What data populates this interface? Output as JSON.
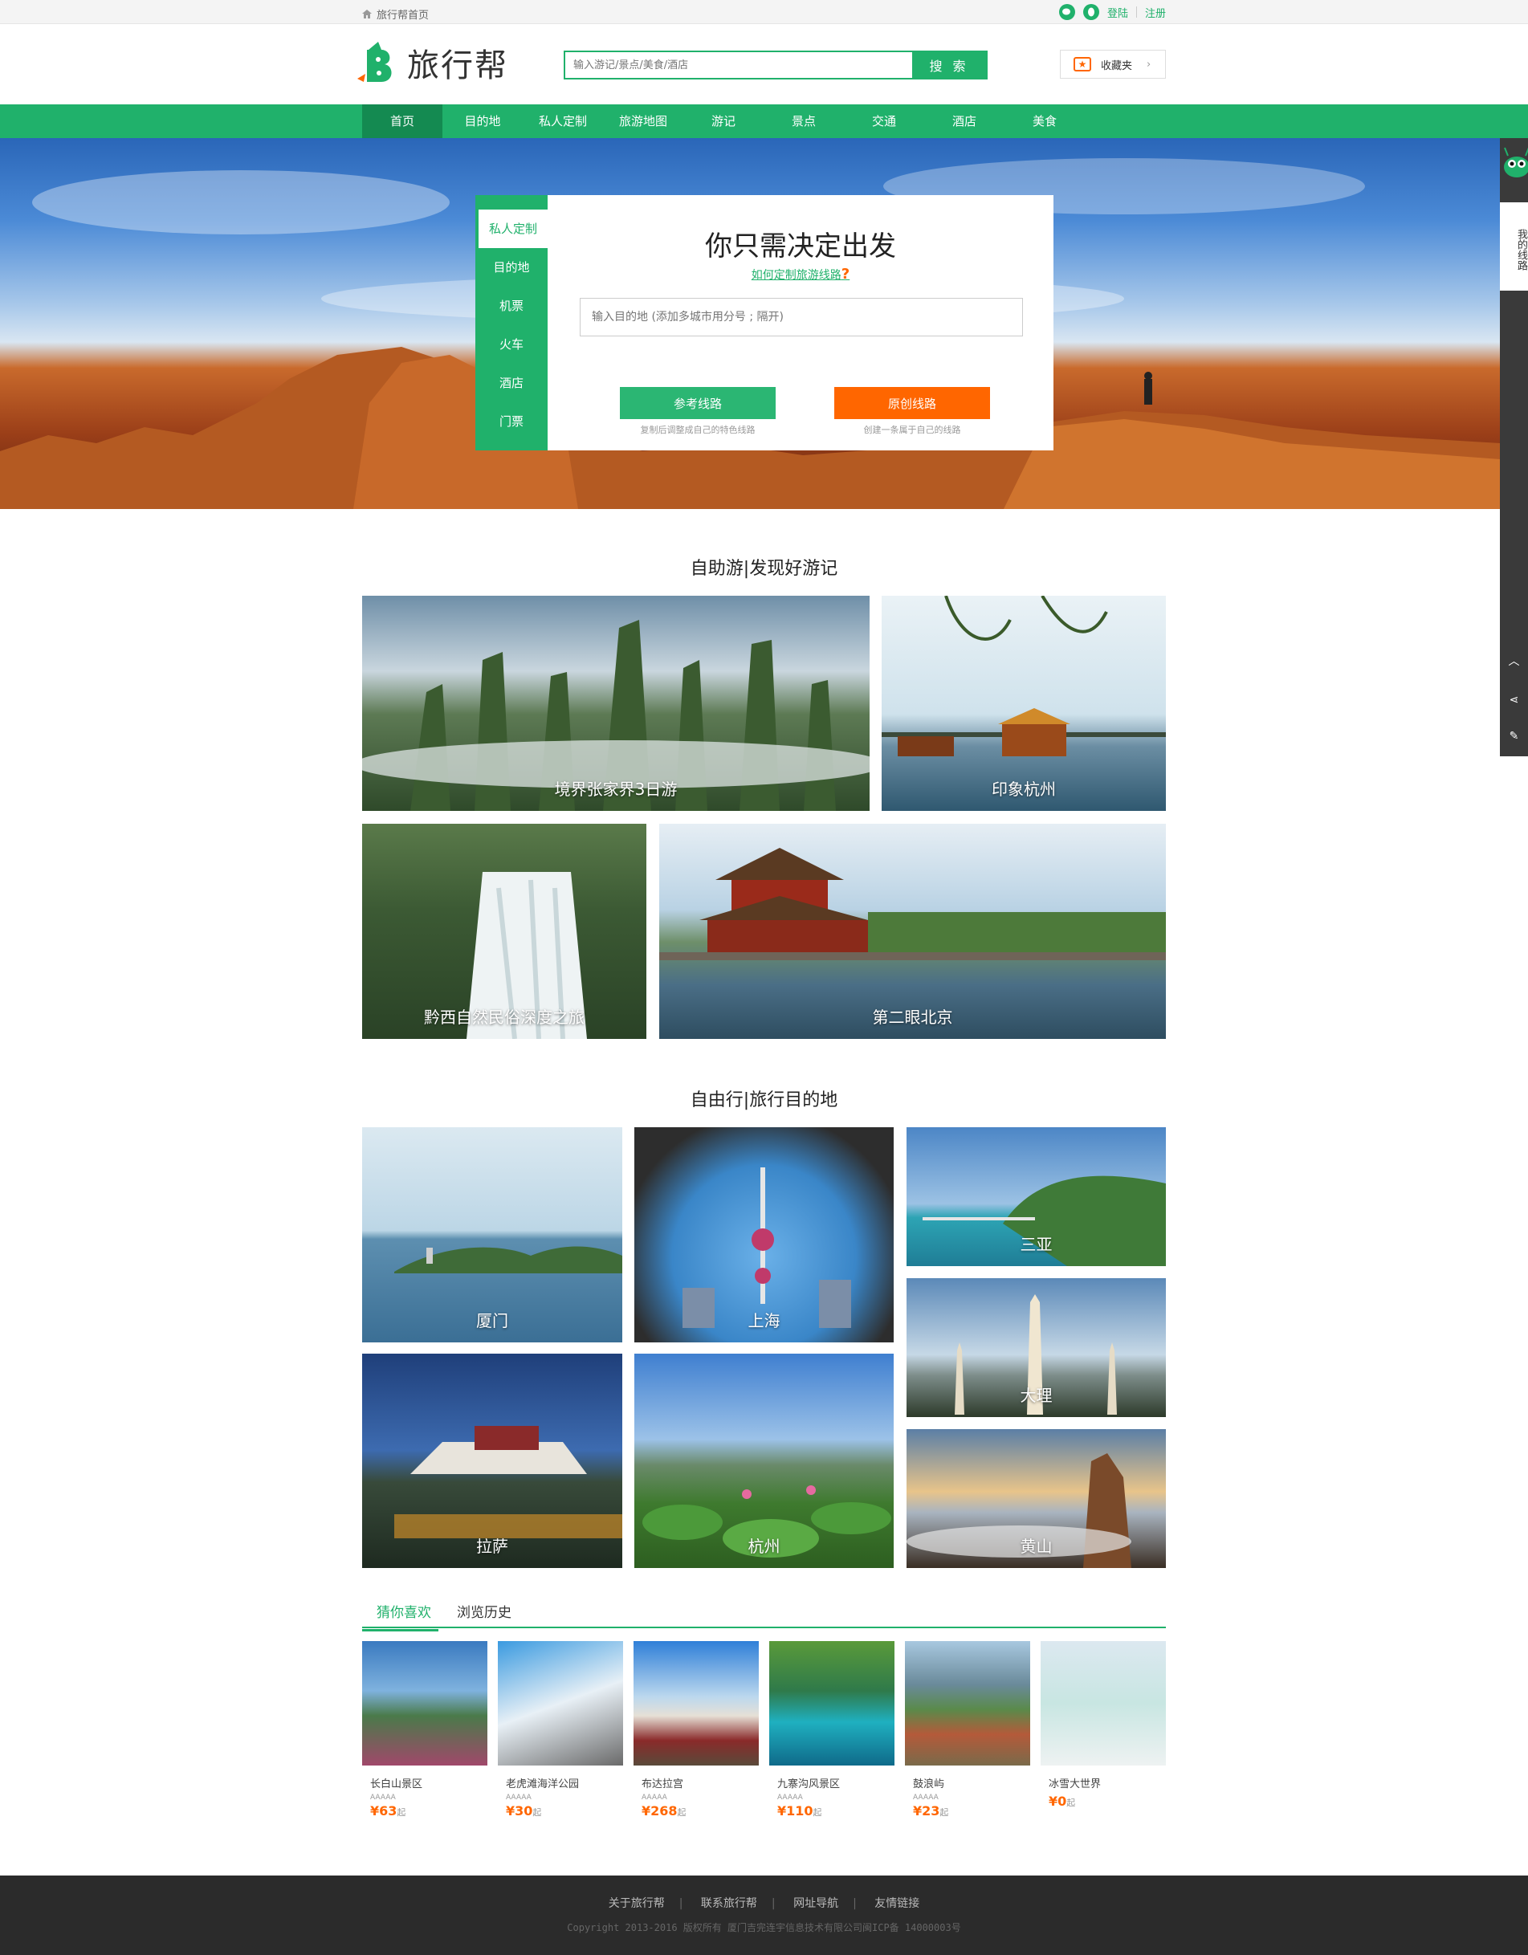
{
  "topbar": {
    "home": "旅行帮首页",
    "login": "登陆",
    "register": "注册",
    "social_icons": [
      "wechat-icon",
      "qq-icon"
    ]
  },
  "header": {
    "logo_text": "旅行帮",
    "search_placeholder": "输入游记/景点/美食/酒店",
    "search_button": "搜 索",
    "favorites": "收藏夹"
  },
  "nav": [
    "首页",
    "目的地",
    "私人定制",
    "旅游地图",
    "游记",
    "景点",
    "交通",
    "酒店",
    "美食"
  ],
  "hero": {
    "tabs": [
      "私人定制",
      "目的地",
      "机票",
      "火车",
      "酒店",
      "门票"
    ],
    "title": "你只需决定出发",
    "link": "如何定制旅游线路",
    "link_icon": "question-icon",
    "input_placeholder": "输入目的地 (添加多城市用分号 ; 隔开)",
    "btn_ref": "参考线路",
    "btn_ref_sub": "复制后调整成自己的特色线路",
    "btn_orig": "原创线路",
    "btn_orig_sub": "创建一条属于自己的线路"
  },
  "float": {
    "mine": "我的线路",
    "icons": [
      "chevron-up-icon",
      "share-icon",
      "edit-icon"
    ]
  },
  "section1": {
    "title": "自助游|发现好游记",
    "tiles": [
      "境界张家界3日游",
      "印象杭州",
      "黔西自然民俗深度之旅",
      "第二眼北京"
    ]
  },
  "section2": {
    "title": "自由行|旅行目的地",
    "tiles": [
      "厦门",
      "上海",
      "三亚",
      "大理",
      "拉萨",
      "杭州",
      "黄山"
    ]
  },
  "guess": {
    "tab_active": "猜你喜欢",
    "tab_other": "浏览历史",
    "cards": [
      {
        "name": "长白山景区",
        "stars": "AAAAA",
        "price": "¥63",
        "unit": "起"
      },
      {
        "name": "老虎滩海洋公园",
        "stars": "AAAAA",
        "price": "¥30",
        "unit": "起"
      },
      {
        "name": "布达拉宫",
        "stars": "AAAAA",
        "price": "¥268",
        "unit": "起"
      },
      {
        "name": "九寨沟风景区",
        "stars": "AAAAA",
        "price": "¥110",
        "unit": "起"
      },
      {
        "name": "鼓浪屿",
        "stars": "AAAAA",
        "price": "¥23",
        "unit": "起"
      },
      {
        "name": "冰雪大世界",
        "stars": "",
        "price": "¥0",
        "unit": "起"
      }
    ]
  },
  "footer": {
    "links": [
      "关于旅行帮",
      "联系旅行帮",
      "网址导航",
      "友情链接"
    ],
    "copyright": "Copyright 2013-2016 版权所有 厦门吉完连宇信息技术有限公司闽ICP备 14000003号"
  },
  "colors": {
    "brand": "#20b16b",
    "accent": "#ff6600",
    "footer": "#2b2b2b"
  }
}
